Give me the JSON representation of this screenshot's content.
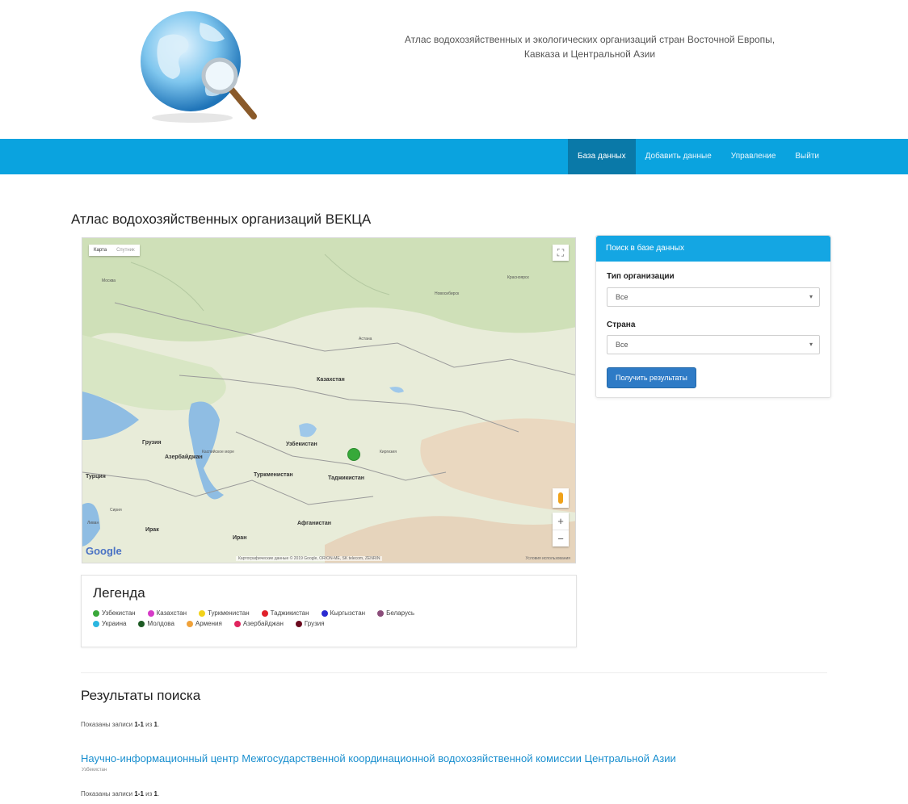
{
  "header": {
    "title_line1": "Атлас водохозяйственных и экологических организаций стран Восточной Европы,",
    "title_line2": "Кавказа и Центральной Азии"
  },
  "nav": {
    "items": [
      {
        "label": "База данных",
        "active": true
      },
      {
        "label": "Добавить данные",
        "active": false
      },
      {
        "label": "Управление",
        "active": false
      },
      {
        "label": "Выйти",
        "active": false
      }
    ]
  },
  "page": {
    "title": "Атлас водохозяйственных организаций ВЕКЦА"
  },
  "map": {
    "type_options": [
      "Карта",
      "Спутник"
    ],
    "zoom_in": "+",
    "zoom_out": "−",
    "logo": "Google",
    "credit": "Картографические данные © 2019 Google, ORION-ME, SK telecom, ZENRIN",
    "terms": "Условия использования",
    "labels": {
      "moscow": "Москва",
      "kazakhstan": "Казахстан",
      "astana": "Астана",
      "novosibirsk": "Новосибирск",
      "krasnoyarsk": "Красноярск",
      "georgia": "Грузия",
      "azerbaijan": "Азербайджан",
      "turkey": "Турция",
      "uzbekistan": "Узбекистан",
      "kyrgyzstan": "Киргизия",
      "turkmenistan": "Туркменистан",
      "tajikistan": "Таджикистан",
      "afghanistan": "Афганистан",
      "iran": "Иран",
      "iraq": "Ирак",
      "syria": "Сирия",
      "lebanon": "Ливан",
      "caspian": "Каспийское море"
    }
  },
  "legend": {
    "title": "Легенда",
    "row1": [
      {
        "label": "Узбекистан",
        "color": "#3aa83a"
      },
      {
        "label": "Казахстан",
        "color": "#d63ac7"
      },
      {
        "label": "Туркменистан",
        "color": "#f2d21b"
      },
      {
        "label": "Таджикистан",
        "color": "#e0202a"
      },
      {
        "label": "Кыргызстан",
        "color": "#2a2ad1"
      },
      {
        "label": "Беларусь",
        "color": "#8b4d7a"
      }
    ],
    "row2": [
      {
        "label": "Украина",
        "color": "#2bb6e0"
      },
      {
        "label": "Молдова",
        "color": "#1d5a24"
      },
      {
        "label": "Армения",
        "color": "#f0a23a"
      },
      {
        "label": "Азербайджан",
        "color": "#e0245e"
      },
      {
        "label": "Грузия",
        "color": "#6a0a1e"
      }
    ]
  },
  "search": {
    "heading": "Поиск в базе данных",
    "org_type_label": "Тип организации",
    "org_type_value": "Все",
    "country_label": "Страна",
    "country_value": "Все",
    "submit": "Получить результаты"
  },
  "results": {
    "title": "Результаты поиска",
    "count_prefix": "Показаны записи ",
    "count_range": "1-1",
    "count_mid": " из ",
    "count_total": "1",
    "count_suffix": ".",
    "items": [
      {
        "title": "Научно-информационный центр Межгосударственной координационной водохозяйственной комиссии Центральной Азии",
        "country": "Узбекистан"
      }
    ]
  }
}
